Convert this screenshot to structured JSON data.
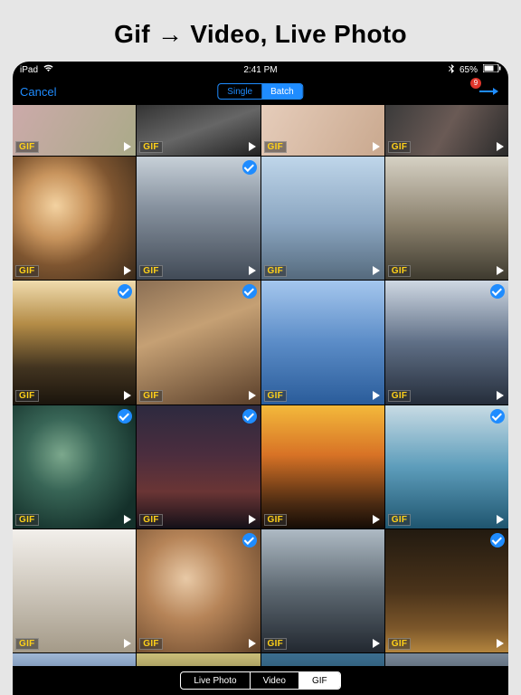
{
  "headline": "Gif → Video, Live Photo",
  "status": {
    "device": "iPad",
    "wifi_icon": "wifi-icon",
    "time": "2:41 PM",
    "bluetooth_icon": "bluetooth-icon",
    "battery_pct": "65%",
    "battery_icon": "battery-icon"
  },
  "nav": {
    "cancel": "Cancel",
    "single": "Single",
    "batch": "Batch",
    "active_segment": "Batch",
    "badge_count": "9"
  },
  "gif_label": "GIF",
  "bottom": {
    "live_photo": "Live Photo",
    "video": "Video",
    "gif": "GIF",
    "active": "GIF"
  },
  "rows": [
    {
      "half": "top",
      "tiles": [
        {
          "bg": "linear-gradient(120deg,#caa,#aa8)"
        },
        {
          "bg": "linear-gradient(160deg,#333,#666,#222)"
        },
        {
          "bg": "linear-gradient(120deg,#e6cdbb,#c9a88e)"
        },
        {
          "bg": "linear-gradient(120deg,#3a3a3a,#6a5a55,#2a2a2a)"
        }
      ]
    },
    {
      "tiles": [
        {
          "bg": "radial-gradient(circle at 35% 40%, #f3d2a1 0%, #c8945d 30%, #7e5530 55%, #3a2a1a 100%)"
        },
        {
          "bg": "linear-gradient(180deg,#c7d0d8 0%, #8893a0 40%, #414a56 100%)",
          "checked": true
        },
        {
          "bg": "linear-gradient(180deg,#bfd6ea 0%, #8aa5c0 55%, #556a7d 100%)"
        },
        {
          "bg": "linear-gradient(180deg,#d6d1c4 0%, #8a806c 55%, #3e3a2f 100%)"
        }
      ]
    },
    {
      "tiles": [
        {
          "bg": "linear-gradient(180deg,#f0dcae 0%, #b48c47 35%, #423420 70%, #1a140c 100%)",
          "checked": true
        },
        {
          "bg": "linear-gradient(160deg,#8b6f54 0%, #c5a074 40%, #5a3f2a 100%)",
          "checked": true
        },
        {
          "bg": "linear-gradient(180deg,#a5c7ee 0%, #5b8cc7 50%, #2a5c9a 100%)"
        },
        {
          "bg": "linear-gradient(180deg,#cfd8e3 0%, #5f6f86 50%, #252d3a 100%)",
          "checked": true
        }
      ]
    },
    {
      "tiles": [
        {
          "bg": "radial-gradient(circle at 40% 40%, #7ca88d 0%, #386556 35%, #14302a 80%)",
          "checked": true
        },
        {
          "bg": "linear-gradient(180deg,#2d2a3f 0%, #4b2d3e 40%, #6a3535 70%, #141018 100%)",
          "checked": true
        },
        {
          "bg": "linear-gradient(180deg,#f3b93b 0%, #d87326 40%, #4a2a12 80%, #150c05 100%)"
        },
        {
          "bg": "linear-gradient(180deg,#c8dbe4 0%, #5d9dbb 50%, #1f556f 100%)",
          "checked": true
        }
      ]
    },
    {
      "tiles": [
        {
          "bg": "linear-gradient(180deg,#f2efeb 0%, #d5cfc5 40%, #a49a88 100%)"
        },
        {
          "bg": "radial-gradient(circle at 40% 40%, #e8c9a6 0%, #b68458 40%, #5e3f26 100%)",
          "checked": true
        },
        {
          "bg": "linear-gradient(180deg,#aebac4 0%, #5c6770 50%, #222830 100%)"
        },
        {
          "bg": "linear-gradient(180deg,#221a10 0%, #4a331a 50%, #7b562a 80%, #b3853e 100%)",
          "checked": true
        }
      ]
    },
    {
      "half": "bottom",
      "tiles": [
        {
          "bg": "linear-gradient(180deg,#a0b8d6,#4a648a)"
        },
        {
          "bg": "linear-gradient(180deg,#cbbf7a,#6e6536)"
        },
        {
          "bg": "linear-gradient(180deg,#3c6e8f,#224c65)"
        },
        {
          "bg": "linear-gradient(180deg,#7a8999,#3a4653)"
        }
      ]
    }
  ]
}
